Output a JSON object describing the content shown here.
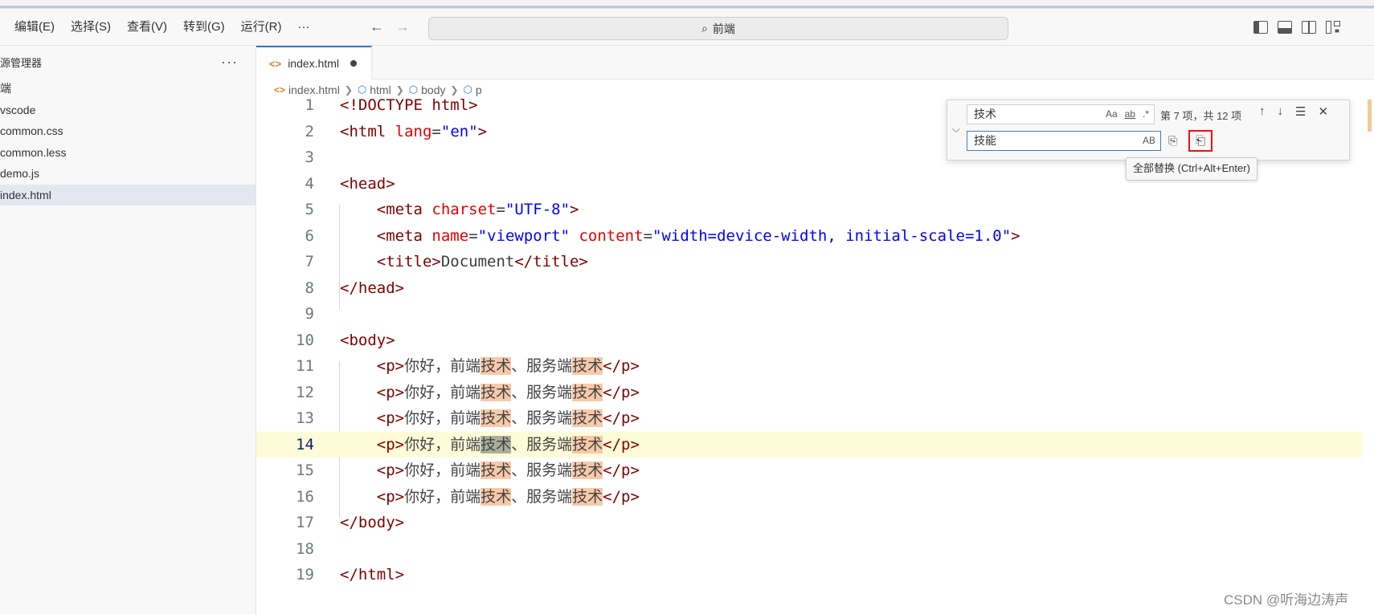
{
  "menu": {
    "items": [
      "编辑(E)",
      "选择(S)",
      "查看(V)",
      "转到(G)",
      "运行(R)",
      "···"
    ]
  },
  "command_center": {
    "text": "前端"
  },
  "sidebar": {
    "title": "源管理器",
    "more": "···",
    "items": [
      {
        "label": "端"
      },
      {
        "label": "vscode"
      },
      {
        "label": "common.css"
      },
      {
        "label": "common.less"
      },
      {
        "label": "demo.js"
      },
      {
        "label": "index.html",
        "active": true
      }
    ]
  },
  "tab": {
    "label": "index.html",
    "icon": "code-icon"
  },
  "breadcrumb": [
    "index.html",
    "html",
    "body",
    "p"
  ],
  "code": {
    "lines": [
      {
        "n": "1"
      },
      {
        "n": "2"
      },
      {
        "n": "3"
      },
      {
        "n": "4"
      },
      {
        "n": "5"
      },
      {
        "n": "6"
      },
      {
        "n": "7"
      },
      {
        "n": "8"
      },
      {
        "n": "9"
      },
      {
        "n": "10"
      },
      {
        "n": "11"
      },
      {
        "n": "12"
      },
      {
        "n": "13"
      },
      {
        "n": "14",
        "current": true
      },
      {
        "n": "15"
      },
      {
        "n": "16"
      },
      {
        "n": "17"
      },
      {
        "n": "18"
      },
      {
        "n": "19"
      }
    ],
    "doctype": "<!DOCTYPE html>",
    "html_open": "<html",
    "lang_attr": "lang",
    "lang_val": "\"en\"",
    "head_open": "<head>",
    "meta": "<meta",
    "charset_attr": "charset",
    "charset_val": "\"UTF-8\"",
    "name_attr": "name",
    "name_val": "\"viewport\"",
    "content_attr": "content",
    "content_val": "\"width=device-width, initial-scale=1.0\"",
    "title_open": "<title>",
    "title_text": "Document",
    "title_close": "</title>",
    "head_close": "</head>",
    "body_open": "<body>",
    "p_open": "<p>",
    "p_close": "</p>",
    "p_text_1": "你好，前端",
    "p_text_match": "技术",
    "p_text_2": "、服务端",
    "body_close": "</body>",
    "html_close": "</html>"
  },
  "find_widget": {
    "find_value": "技术",
    "replace_value": "技能",
    "options": [
      "Aa",
      "ab",
      ".*"
    ],
    "count": "第 7 项，共 12 项",
    "preserve_case": "AB",
    "tooltip": "全部替换 (Ctrl+Alt+Enter)"
  },
  "watermark": "CSDN @听海边涛声"
}
